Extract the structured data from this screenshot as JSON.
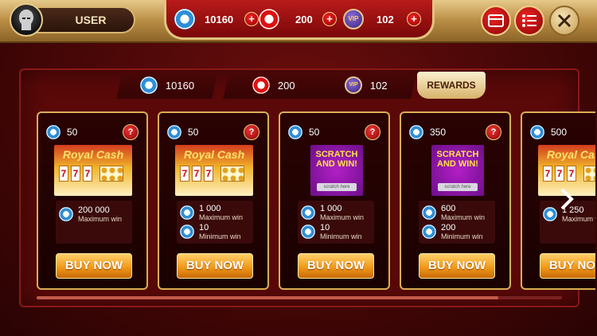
{
  "header": {
    "user_name": "USER",
    "currencies": [
      {
        "icon": "blue-chip-icon",
        "value": "10160"
      },
      {
        "icon": "red-chip-icon",
        "value": "200"
      },
      {
        "icon": "vip-icon",
        "label": "VIP",
        "value": "102"
      }
    ],
    "buttons": [
      "card-icon",
      "list-icon",
      "close-icon"
    ]
  },
  "tabs": [
    {
      "icon": "blue-chip-icon",
      "value": "10160"
    },
    {
      "icon": "red-chip-icon",
      "value": "200"
    },
    {
      "icon": "vip-icon",
      "label": "VIP",
      "value": "102"
    },
    {
      "label": "REWARDS",
      "active": true
    }
  ],
  "cards": [
    {
      "price": "50",
      "ticket": "Royal Cash",
      "wins": [
        {
          "amount": "200 000",
          "label": "Maximum win"
        }
      ],
      "button": "BUY NOW"
    },
    {
      "price": "50",
      "ticket": "Royal Cash",
      "wins": [
        {
          "amount": "1 000",
          "label": "Maximum win"
        },
        {
          "amount": "10",
          "label": "Minimum win"
        }
      ],
      "button": "BUY NOW"
    },
    {
      "price": "50",
      "ticket": "SCRATCH AND WIN!",
      "ticket_sub": "scratch here",
      "wins": [
        {
          "amount": "1 000",
          "label": "Maximum win"
        },
        {
          "amount": "10",
          "label": "Minimum win"
        }
      ],
      "button": "BUY NOW"
    },
    {
      "price": "350",
      "ticket": "SCRATCH AND WIN!",
      "ticket_sub": "scratch here",
      "wins": [
        {
          "amount": "600",
          "label": "Maximum win"
        },
        {
          "amount": "200",
          "label": "Minimum win"
        }
      ],
      "button": "BUY NOW"
    },
    {
      "price": "500",
      "ticket": "Royal Cash",
      "wins": [
        {
          "amount": "1 250",
          "label": "Maximum win"
        }
      ],
      "button": "BUY NOW"
    }
  ],
  "help_label": "?",
  "plus_label": "+",
  "colors": {
    "gold": "#d9ae52",
    "red": "#b91a1a",
    "button_orange": "#f19a1a"
  }
}
